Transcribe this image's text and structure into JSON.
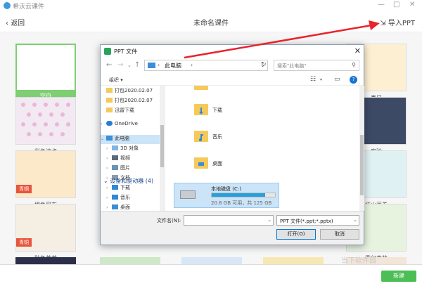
{
  "app": {
    "title": "希沃云课件",
    "logo_icon": "cloud-logo-icon"
  },
  "window_controls": [
    "—",
    "□",
    "✕"
  ],
  "navbar": {
    "back_label": "返回",
    "doc_title": "未命名课件",
    "import_label": "导入PPT"
  },
  "templates": [
    {
      "label": "空白",
      "selected": true,
      "badge": "",
      "color": "#ffffff"
    },
    {
      "label": "彩色波点",
      "selected": false,
      "badge": "",
      "color": "#f3e9f3"
    },
    {
      "label": "橙色风车",
      "selected": false,
      "badge": "青铜",
      "color": "#fbe9c9"
    },
    {
      "label": "秋色芦苇",
      "selected": false,
      "badge": "青铜",
      "color": "#f5efe3"
    },
    {
      "label": "喜尺",
      "selected": false,
      "badge": "",
      "color": "#fdf0d2"
    },
    {
      "label": "实验",
      "selected": false,
      "badge": "",
      "color": "#3d4a66"
    },
    {
      "label": "红山画卷",
      "selected": false,
      "badge": "",
      "color": "#dff1f3"
    },
    {
      "label": "委幻森林",
      "selected": false,
      "badge": "",
      "color": "#e7f3df"
    }
  ],
  "new_button": "新建",
  "watermark": "当下软件园",
  "dialog": {
    "title": "PPT 文件",
    "close": "✕",
    "breadcrumb": "此电脑",
    "search_placeholder": "搜索\"此电脑\"",
    "organize_label": "组织 ▾",
    "help": "?",
    "nav_items": [
      {
        "label": "打包2020.02.07",
        "type": "folder",
        "chev": "",
        "selected": false
      },
      {
        "label": "打包2020.02.07",
        "type": "folder",
        "chev": "",
        "selected": false
      },
      {
        "label": "迅雷下载",
        "type": "folder",
        "chev": "",
        "selected": false
      },
      {
        "label": "",
        "type": "spacer",
        "chev": "",
        "selected": false
      },
      {
        "label": "OneDrive",
        "type": "cloud",
        "chev": "›",
        "selected": false
      },
      {
        "label": "",
        "type": "spacer",
        "chev": "",
        "selected": false
      },
      {
        "label": "此电脑",
        "type": "pc",
        "chev": "⌄",
        "selected": true
      },
      {
        "label": "3D 对象",
        "type": "obj3d",
        "chev": "›",
        "selected": false
      },
      {
        "label": "视频",
        "type": "video",
        "chev": "›",
        "selected": false
      },
      {
        "label": "图片",
        "type": "picture",
        "chev": "›",
        "selected": false
      },
      {
        "label": "文档",
        "type": "doc",
        "chev": "›",
        "selected": false
      },
      {
        "label": "下载",
        "type": "download",
        "chev": "›",
        "selected": false
      },
      {
        "label": "音乐",
        "type": "music",
        "chev": "›",
        "selected": false
      },
      {
        "label": "桌面",
        "type": "desktop",
        "chev": "›",
        "selected": false
      }
    ],
    "folders": [
      {
        "label": "下载",
        "overlay": "download",
        "overlay_color": "#2f87d8"
      },
      {
        "label": "音乐",
        "overlay": "music",
        "overlay_color": "#2f87d8"
      },
      {
        "label": "桌面",
        "overlay": "desktop",
        "overlay_color": "#3a8fd8"
      }
    ],
    "devices_section": "⌄ 设备和驱动器 (4)",
    "drive": {
      "name": "本地磁盘 (C:)",
      "usage": "20.6 GB 可用，共 125 GB",
      "used_fraction": 0.84
    },
    "filename_label": "文件名(N):",
    "filename_value": "",
    "filetype_value": "PPT 文件(*.ppt;*.pptx)",
    "open_label": "打开(O)",
    "cancel_label": "取消"
  },
  "colors": {
    "accent_green": "#4bbe55",
    "selected_green": "#7dcf72",
    "badge_red": "#e8543c",
    "arrow_red": "#e8232a",
    "selection_blue": "#cce4f7"
  }
}
